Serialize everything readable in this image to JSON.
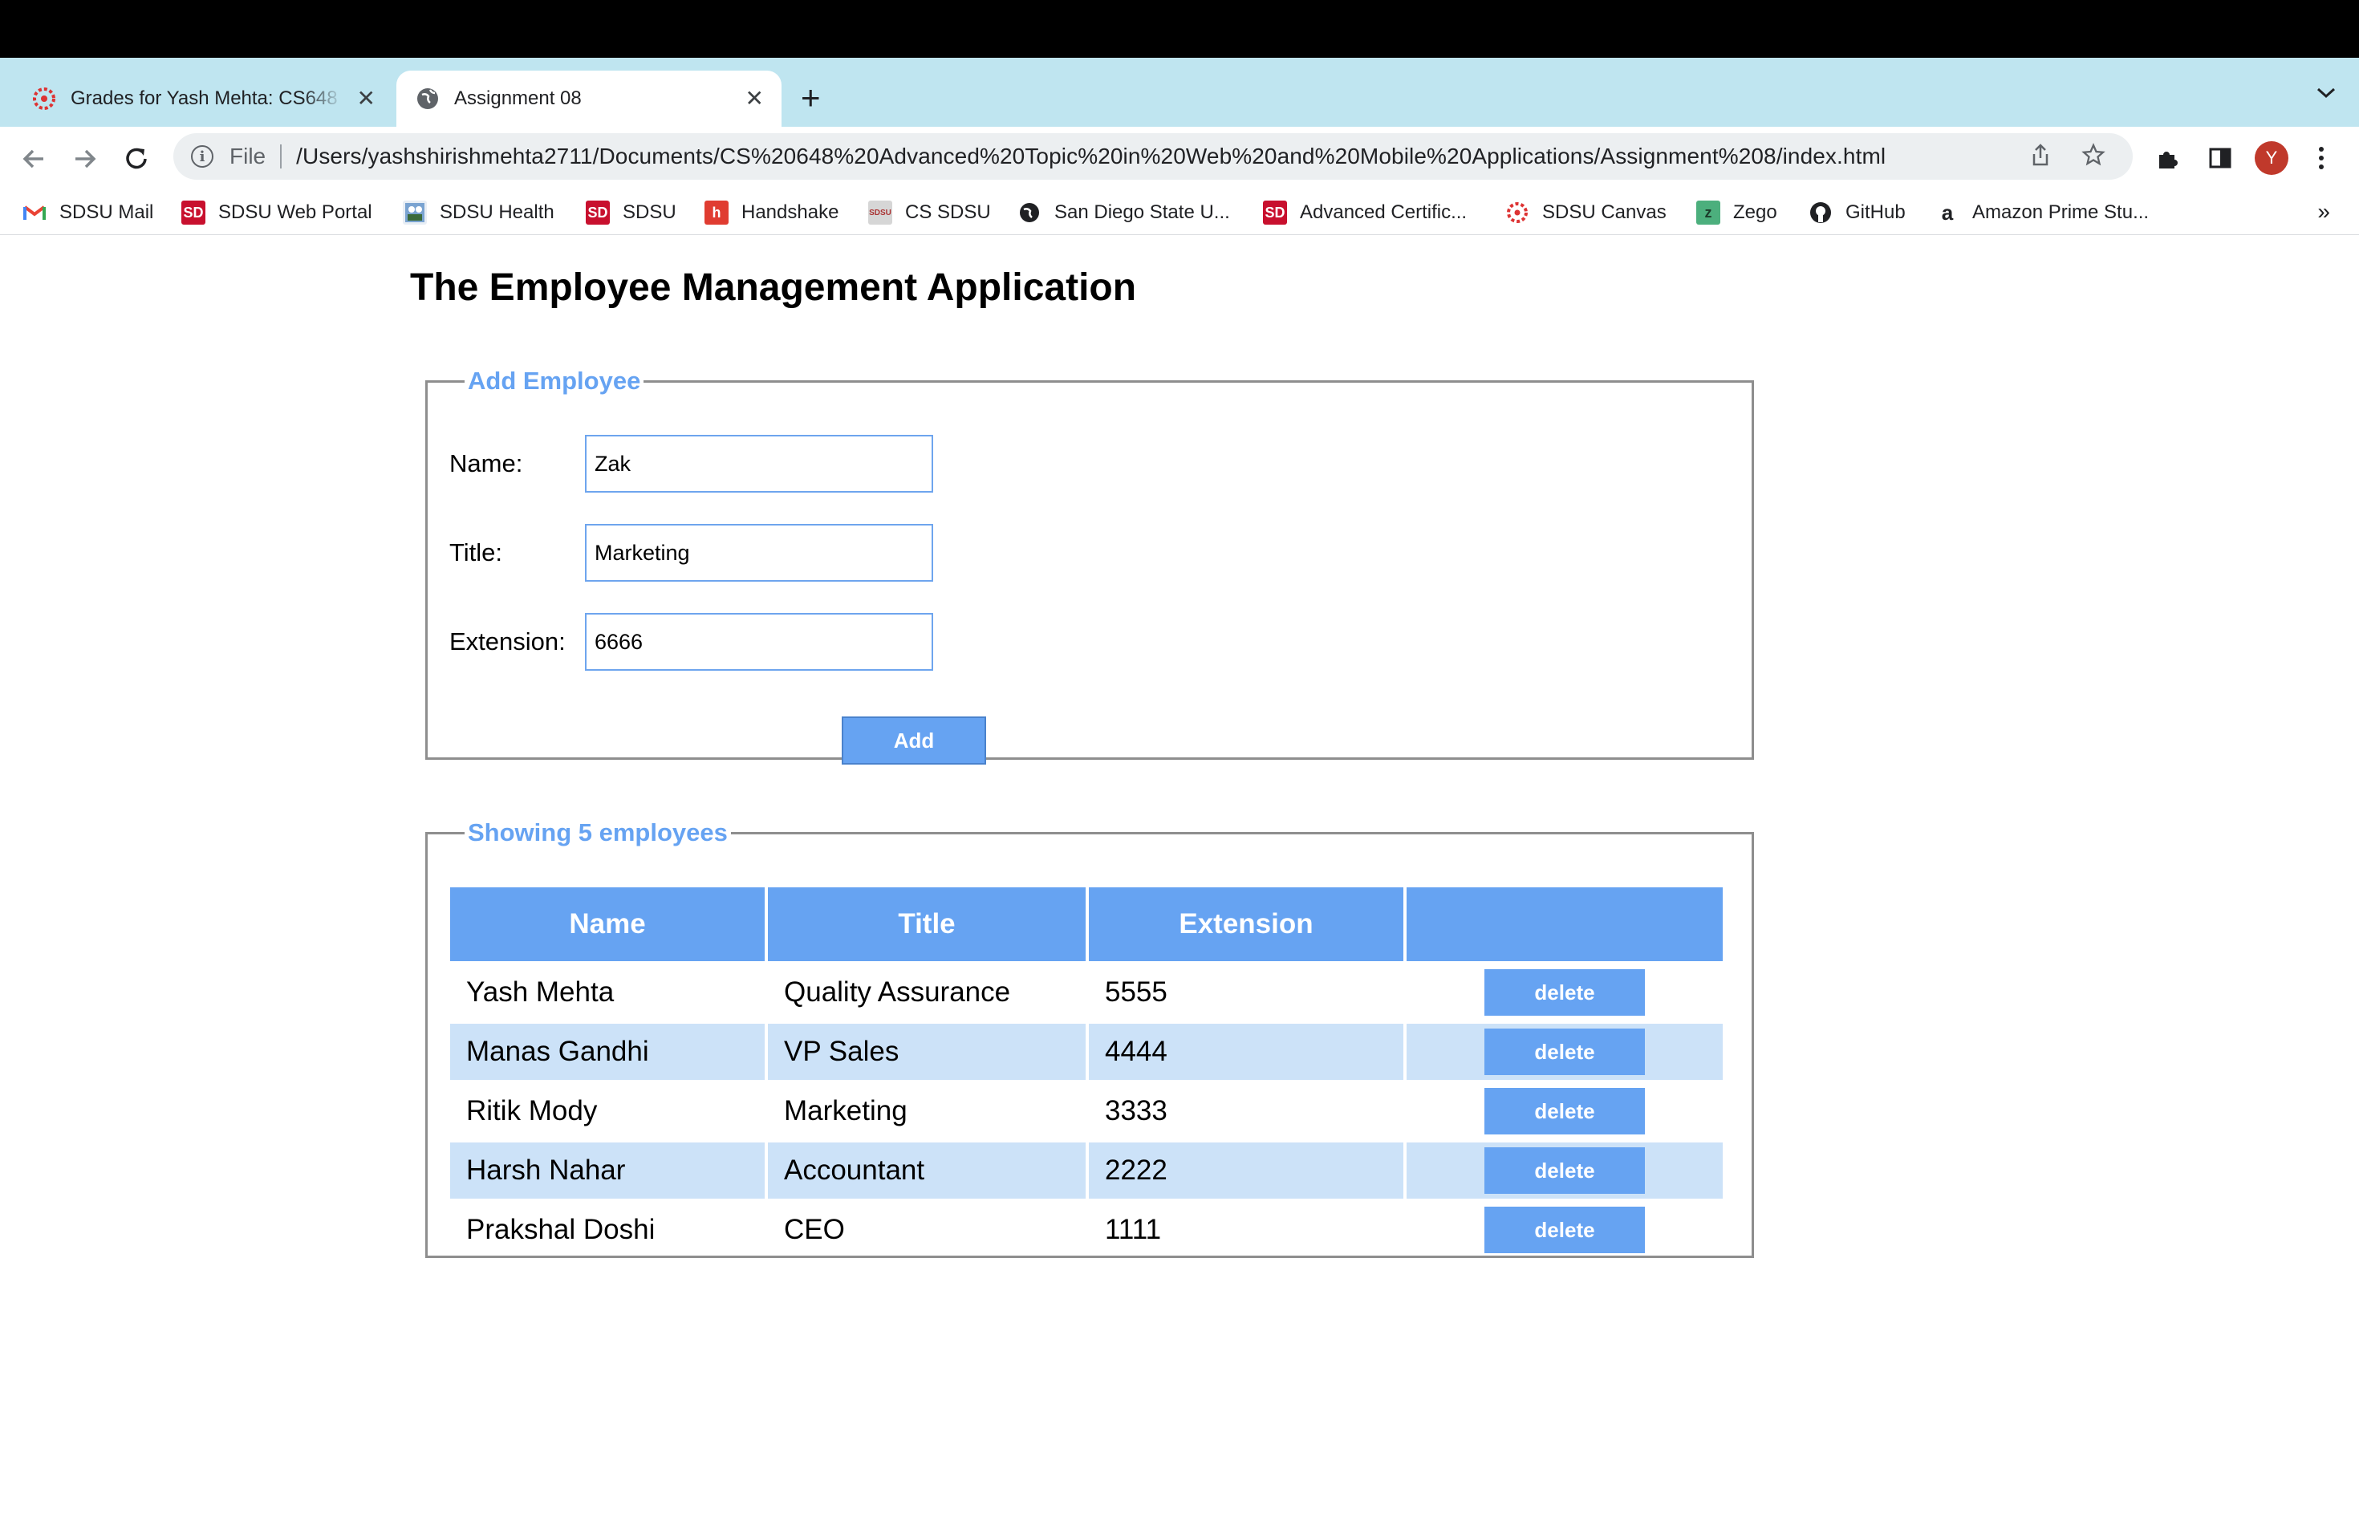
{
  "browser": {
    "tabs": [
      {
        "title": "Grades for Yash Mehta: CS648",
        "close": "✕"
      },
      {
        "title": "Assignment 08",
        "close": "✕"
      }
    ],
    "new_tab": "+",
    "url_scheme": "File",
    "url": "/Users/yashshirishmehta2711/Documents/CS%20648%20Advanced%20Topic%20in%20Web%20and%20Mobile%20Applications/Assignment%208/index.html",
    "profile_initial": "Y",
    "bookmarks": [
      "SDSU Mail",
      "SDSU Web Portal",
      "SDSU Health",
      "SDSU",
      "Handshake",
      "CS SDSU",
      "San Diego State U...",
      "Advanced Certific...",
      "SDSU Canvas",
      "Zego",
      "GitHub",
      "Amazon Prime Stu..."
    ],
    "bookmarks_more": "»"
  },
  "page": {
    "title": "The Employee Management Application",
    "add_form": {
      "legend": "Add Employee",
      "name_label": "Name:",
      "name_value": "Zak",
      "title_label": "Title:",
      "title_value": "Marketing",
      "extension_label": "Extension:",
      "extension_value": "6666",
      "add_button": "Add"
    },
    "list": {
      "legend": "Showing 5 employees",
      "headers": [
        "Name",
        "Title",
        "Extension",
        ""
      ],
      "rows": [
        {
          "name": "Yash Mehta",
          "title": "Quality Assurance",
          "extension": "5555",
          "action": "delete"
        },
        {
          "name": "Manas Gandhi",
          "title": "VP Sales",
          "extension": "4444",
          "action": "delete"
        },
        {
          "name": "Ritik Mody",
          "title": "Marketing",
          "extension": "3333",
          "action": "delete"
        },
        {
          "name": "Harsh Nahar",
          "title": "Accountant",
          "extension": "2222",
          "action": "delete"
        },
        {
          "name": "Prakshal Doshi",
          "title": "CEO",
          "extension": "1111",
          "action": "delete"
        }
      ]
    }
  },
  "colors": {
    "accent": "#66a3f2",
    "row_alt": "#cce2f8",
    "tabstrip": "#bfe5f0"
  }
}
